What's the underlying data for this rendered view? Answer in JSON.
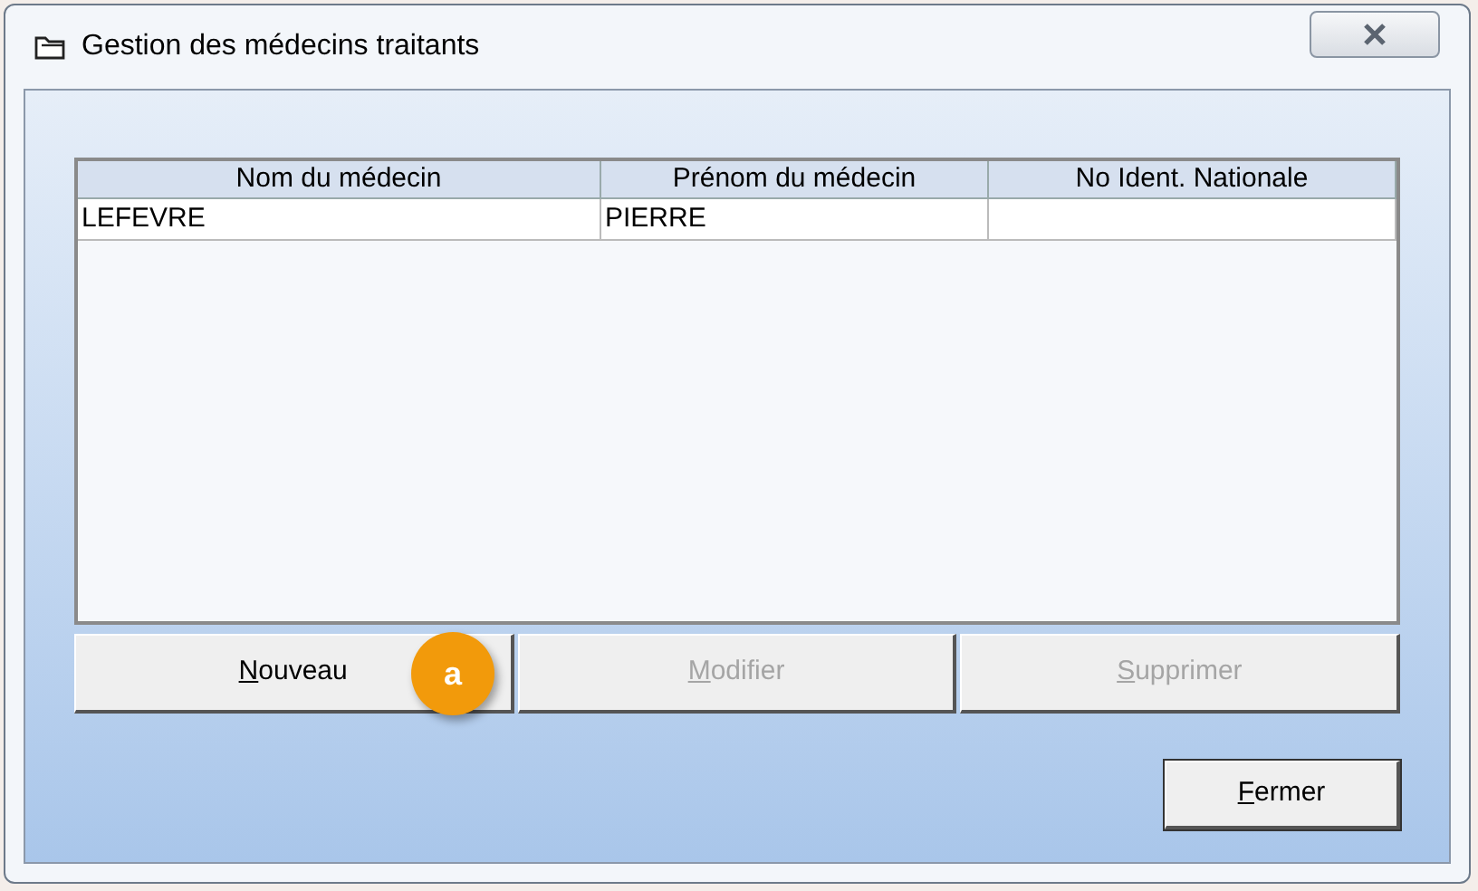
{
  "window": {
    "title": "Gestion des médecins traitants"
  },
  "table": {
    "columns": [
      "Nom du médecin",
      "Prénom du médecin",
      "No Ident. Nationale"
    ],
    "rows": [
      [
        "LEFEVRE",
        "PIERRE",
        ""
      ]
    ]
  },
  "buttons": [
    {
      "label": "Nouveau",
      "disabled": false
    },
    {
      "label": "Modifier",
      "disabled": true
    },
    {
      "label": "Supprimer",
      "disabled": true
    }
  ],
  "callout": "a",
  "close_button": {
    "label": "Fermer",
    "disabled": false
  }
}
